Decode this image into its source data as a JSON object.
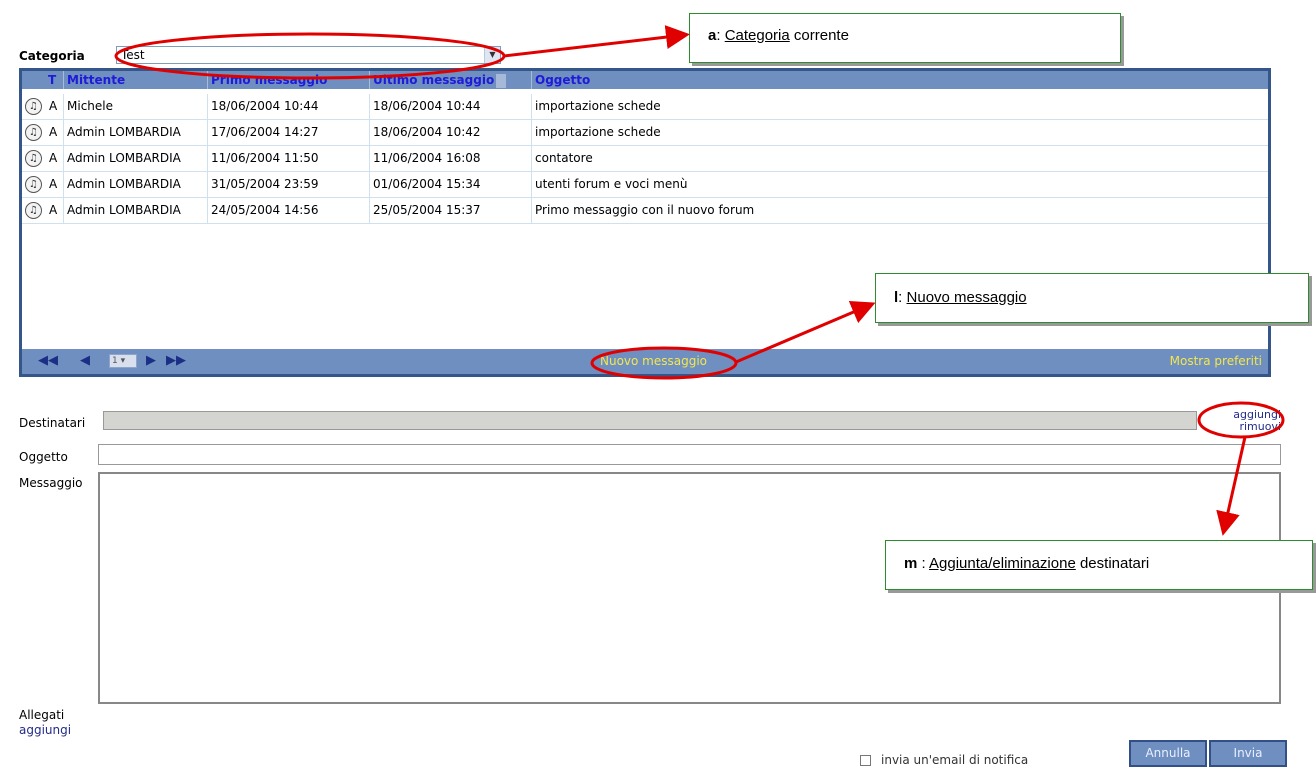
{
  "category": {
    "label": "Categoria",
    "selected": "Test"
  },
  "table": {
    "headers": [
      "T",
      "Mittente",
      "Primo messaggio",
      "Ultimo messaggio",
      "Oggetto"
    ],
    "rows": [
      {
        "t": "A",
        "mittente": "Michele",
        "primo": "18/06/2004 10:44",
        "ultimo": "18/06/2004 10:44",
        "oggetto": "importazione schede"
      },
      {
        "t": "A",
        "mittente": "Admin LOMBARDIA",
        "primo": "17/06/2004 14:27",
        "ultimo": "18/06/2004 10:42",
        "oggetto": "importazione schede"
      },
      {
        "t": "A",
        "mittente": "Admin LOMBARDIA",
        "primo": "11/06/2004 11:50",
        "ultimo": "11/06/2004 16:08",
        "oggetto": "contatore"
      },
      {
        "t": "A",
        "mittente": "Admin LOMBARDIA",
        "primo": "31/05/2004 23:59",
        "ultimo": "01/06/2004 15:34",
        "oggetto": "utenti forum e voci menù"
      },
      {
        "t": "A",
        "mittente": "Admin LOMBARDIA",
        "primo": "24/05/2004 14:56",
        "ultimo": "25/05/2004 15:37",
        "oggetto": "Primo messaggio con il nuovo forum"
      }
    ],
    "footer": {
      "page": "1",
      "new_message": "Nuovo messaggio",
      "show_favorites": "Mostra preferiti"
    }
  },
  "form": {
    "destinatari_label": "Destinatari",
    "add_link": "aggiungi",
    "remove_link": "rimuovi",
    "oggetto_label": "Oggetto",
    "messaggio_label": "Messaggio",
    "allegati_label": "Allegati",
    "allegati_add": "aggiungi",
    "notify_label": "invia un'email di notifica",
    "cancel": "Annulla",
    "send": "Invia"
  },
  "callouts": {
    "a": {
      "key": "a",
      "sep": ": ",
      "term": "Categoria",
      "rest": " corrente"
    },
    "l": {
      "key": "l",
      "sep": ": ",
      "term": "Nuovo messaggio",
      "rest": ""
    },
    "m": {
      "key": "m",
      "sep": " : ",
      "term": "Aggiunta/eliminazione",
      "rest": " destinatari"
    }
  },
  "colors": {
    "header_blue": "#6f8fc0",
    "header_text": "#1f1bd8",
    "footer_link": "#f3e74a",
    "annotation_red": "#e00000"
  }
}
